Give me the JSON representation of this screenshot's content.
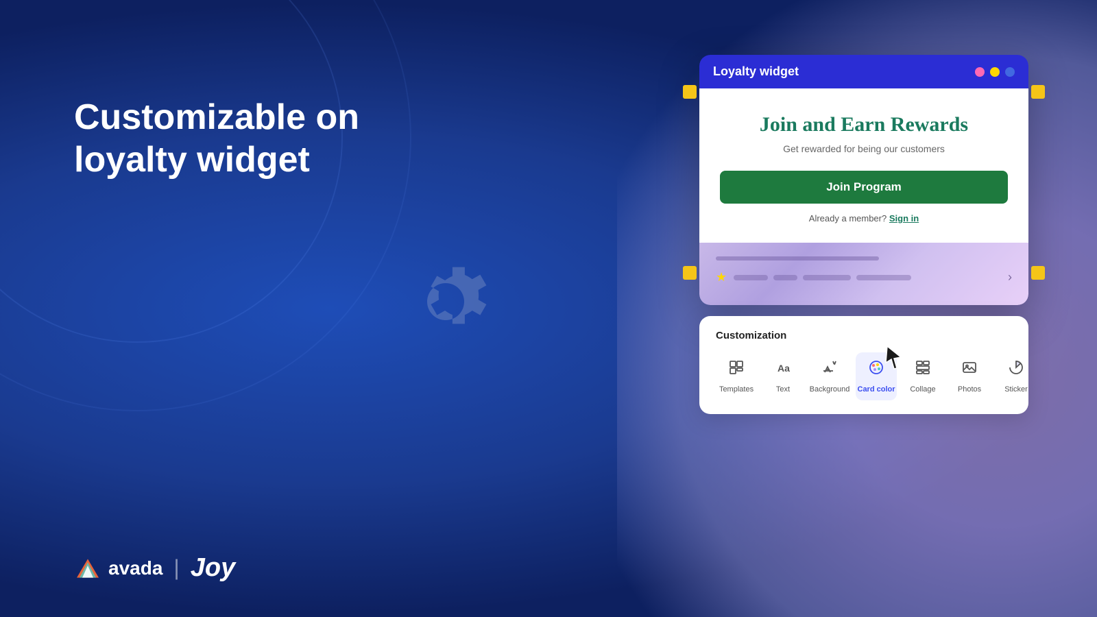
{
  "page": {
    "background": {
      "primary_color": "#1a3a8f",
      "right_gradient": "purple-pink"
    }
  },
  "left_section": {
    "heading_line1": "Customizable on",
    "heading_line2": "loyalty widget"
  },
  "logo": {
    "avada_text": "avada",
    "divider": "|",
    "joy_text": "Joy"
  },
  "loyalty_widget": {
    "title": "Loyalty widget",
    "dots": [
      "pink",
      "yellow",
      "blue"
    ],
    "card": {
      "heading": "Join and Earn Rewards",
      "subheading": "Get rewarded for being our customers",
      "join_button": "Join Program",
      "member_text": "Already a member?",
      "sign_in_link": "Sign in"
    },
    "rewards_section": {
      "has_star": true
    }
  },
  "customization_panel": {
    "title": "Customization",
    "items": [
      {
        "id": "templates",
        "label": "Templates",
        "icon": "template",
        "active": false
      },
      {
        "id": "text",
        "label": "Text",
        "icon": "text",
        "active": false
      },
      {
        "id": "background",
        "label": "Background",
        "icon": "background",
        "active": false
      },
      {
        "id": "card_color",
        "label": "Card color",
        "icon": "palette",
        "active": true
      },
      {
        "id": "collage",
        "label": "Collage",
        "icon": "collage",
        "active": false
      },
      {
        "id": "photos",
        "label": "Photos",
        "icon": "photos",
        "active": false
      },
      {
        "id": "sticker",
        "label": "Sticker",
        "icon": "sticker",
        "active": false
      }
    ]
  }
}
